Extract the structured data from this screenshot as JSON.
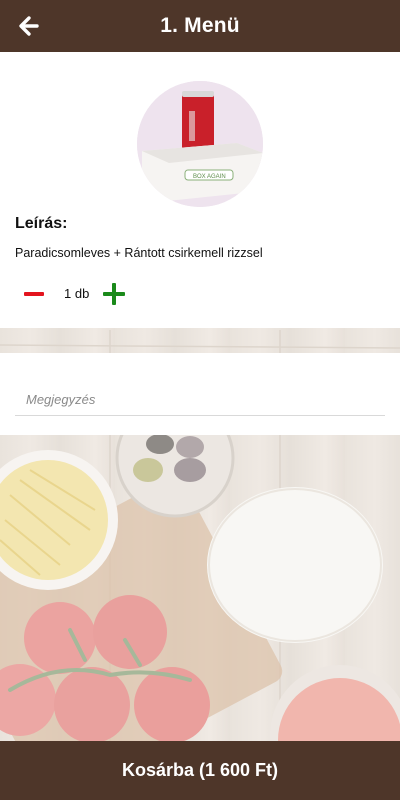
{
  "header": {
    "title": "1. Menü",
    "back_icon": "arrow-left-icon"
  },
  "product": {
    "image_desc": "soda-can-on-box",
    "description_label": "Leírás:",
    "description": "Paradicsomleves + Rántott csirkemell rizzsel",
    "quantity_text": "1 db",
    "minus_icon": "minus-icon",
    "plus_icon": "plus-icon"
  },
  "note": {
    "placeholder": "Megjegyzés",
    "value": ""
  },
  "footer": {
    "cart_label": "Kosárba (1 600 Ft)"
  },
  "colors": {
    "brand_brown": "#4e3629",
    "minus_red": "#e3141e",
    "plus_green": "#1a8a1a"
  }
}
